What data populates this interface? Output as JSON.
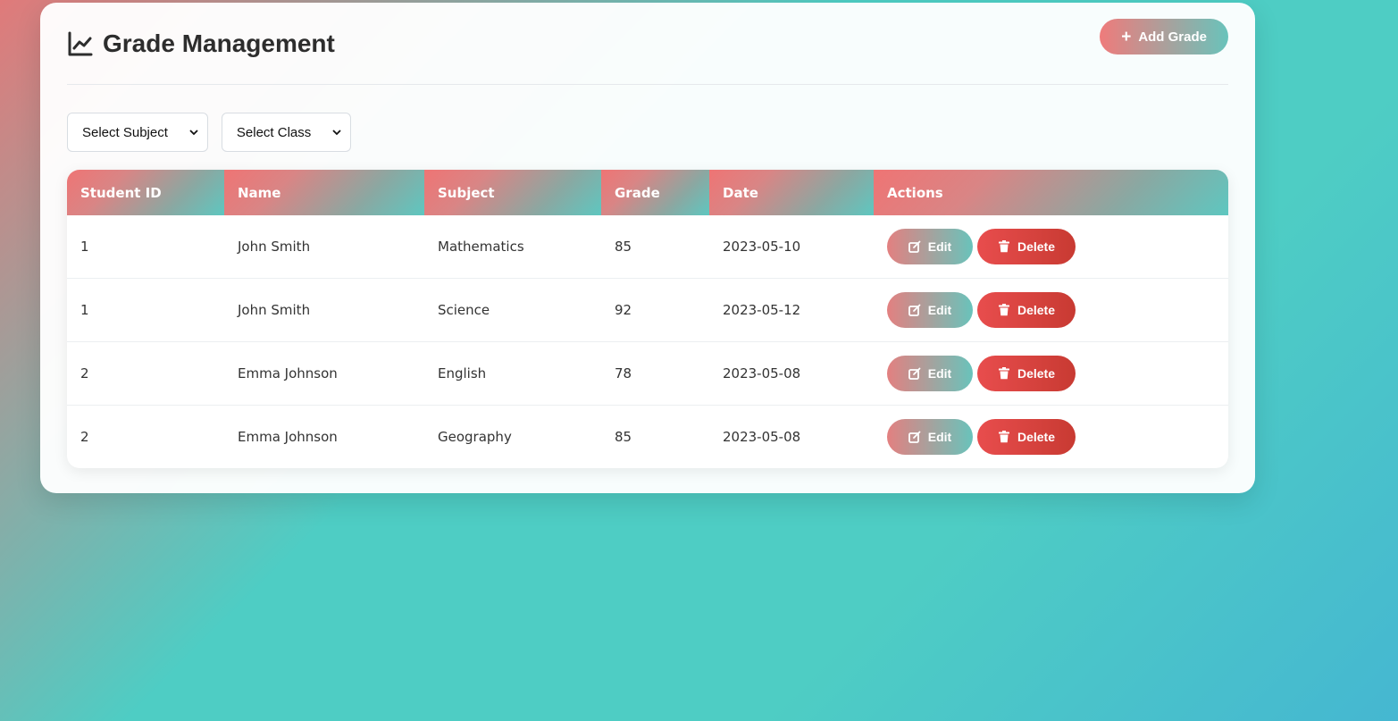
{
  "header": {
    "title": "Grade Management",
    "add_button_label": "Add Grade"
  },
  "filters": {
    "subject_selected": "Select Subject",
    "class_selected": "Select Class"
  },
  "table": {
    "columns": [
      "Student ID",
      "Name",
      "Subject",
      "Grade",
      "Date",
      "Actions"
    ],
    "rows": [
      {
        "student_id": "1",
        "name": "John Smith",
        "subject": "Mathematics",
        "grade": "85",
        "date": "2023-05-10"
      },
      {
        "student_id": "1",
        "name": "John Smith",
        "subject": "Science",
        "grade": "92",
        "date": "2023-05-12"
      },
      {
        "student_id": "2",
        "name": "Emma Johnson",
        "subject": "English",
        "grade": "78",
        "date": "2023-05-08"
      },
      {
        "student_id": "2",
        "name": "Emma Johnson",
        "subject": "Geography",
        "grade": "85",
        "date": "2023-05-08"
      }
    ],
    "edit_label": "Edit",
    "delete_label": "Delete"
  },
  "icons": {
    "title": "chart-line-icon",
    "add": "plus-icon",
    "edit": "edit-icon",
    "delete": "trash-icon"
  },
  "colors": {
    "accent_coral": "#ef7474",
    "accent_teal": "#4ecdc4",
    "delete_red": "#e04545",
    "title_text": "#2d2d2d"
  }
}
